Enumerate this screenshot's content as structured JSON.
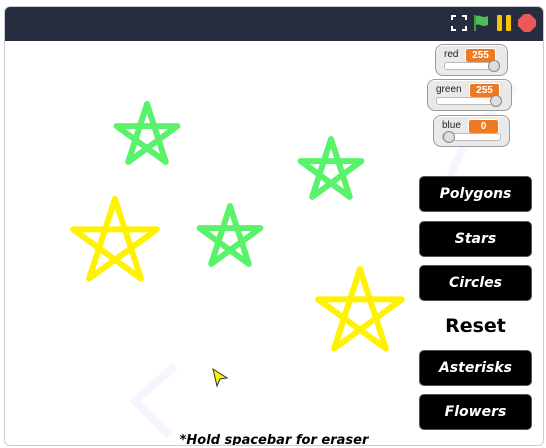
{
  "colors": {
    "topbar": "#262d3e",
    "flag": "#4cbf56",
    "pause": "#f7c600",
    "stop": "#ec5959",
    "green_star": "#5bf26b",
    "yellow_star": "#fff200",
    "slider_value_bg": "#f07a22"
  },
  "controls": {
    "fullscreen_icon": "fullscreen-icon",
    "green_flag_icon": "green-flag-icon",
    "pause_icon": "pause-icon",
    "stop_icon": "stop-icon"
  },
  "sliders": [
    {
      "label": "red",
      "value": "255",
      "level": 1.0
    },
    {
      "label": "green",
      "value": "255",
      "level": 1.0
    },
    {
      "label": "blue",
      "value": "0",
      "level": 0.0
    }
  ],
  "buttons": {
    "polygons": "Polygons",
    "stars": "Stars",
    "circles": "Circles",
    "reset": "Reset",
    "asterisks": "Asterisks",
    "flowers": "Flowers"
  },
  "footnote": "*Hold spacebar for eraser"
}
